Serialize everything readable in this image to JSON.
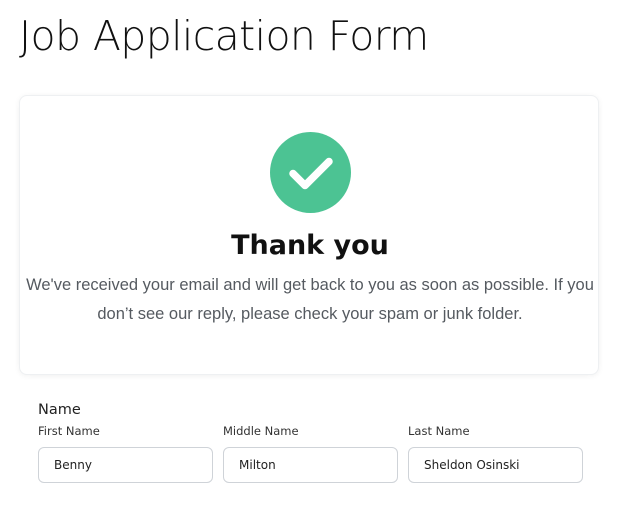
{
  "page": {
    "title": "Job Application Form"
  },
  "confirmation": {
    "icon": "check-circle-icon",
    "accent_color": "#4cc393",
    "title": "Thank you",
    "message": "We've received your email and will get back to you as soon as possible. If you don’t see our reply, please check your spam or junk folder."
  },
  "name_section": {
    "label": "Name",
    "fields": [
      {
        "label": "First Name",
        "value": "Benny"
      },
      {
        "label": "Middle Name",
        "value": "Milton"
      },
      {
        "label": "Last Name",
        "value": "Sheldon Osinski"
      }
    ]
  }
}
